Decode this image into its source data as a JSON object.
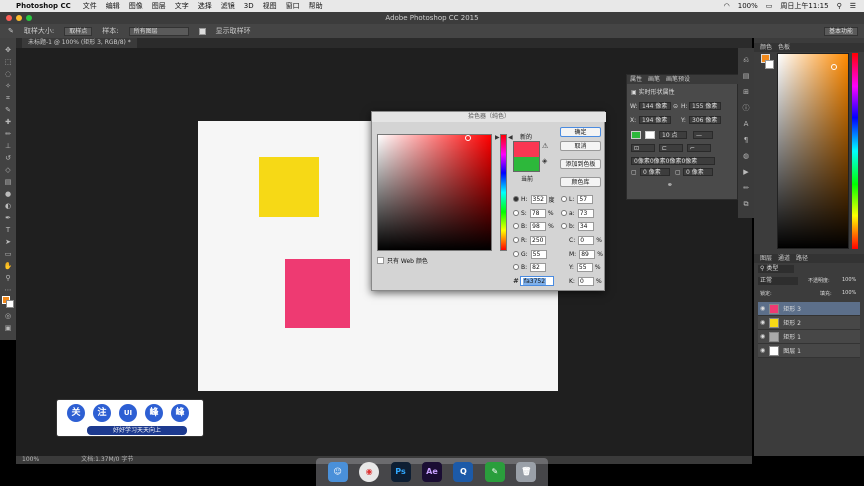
{
  "menubar": {
    "app_name": "Photoshop CC",
    "items": [
      "文件",
      "编辑",
      "图像",
      "图层",
      "文字",
      "选择",
      "滤镜",
      "3D",
      "视图",
      "窗口",
      "帮助"
    ],
    "battery": "100%",
    "clock": "周日上午11:15"
  },
  "window": {
    "title": "Adobe Photoshop CC 2015"
  },
  "options_bar": {
    "sample_size_label": "取样大小:",
    "sample_size_value": "取样点",
    "sample_label": "样本:",
    "sample_value": "所有图层",
    "show_ring_label": "显示取样环",
    "workspace": "基本功能"
  },
  "document": {
    "tab_label": "未标题-1 @ 100% (矩形 3, RGB/8) *",
    "zoom": "100%",
    "doc_info": "文档:1.37M/0 字节"
  },
  "color_picker": {
    "title": "拾色器（纯色）",
    "new_label": "新的",
    "current_label": "当前",
    "new_color": "#fa3752",
    "current_color": "#2db83b",
    "ok": "确定",
    "cancel": "取消",
    "add_swatch": "添加到色板",
    "color_library": "颜色库",
    "web_only": "只有 Web 颜色",
    "hex_label": "#",
    "hex": "fa3752",
    "fields": {
      "H": "352",
      "H_unit": "度",
      "S": "78",
      "S_unit": "%",
      "B": "98",
      "B_unit": "%",
      "R": "250",
      "G": "55",
      "Bl": "82",
      "L": "57",
      "a": "73",
      "b": "34",
      "C": "0",
      "M": "89",
      "Y": "55",
      "K": "0",
      "pct": "%"
    }
  },
  "properties_panel": {
    "tabs": [
      "属性",
      "画笔",
      "画笔预设"
    ],
    "heading": "实时形状属性",
    "W_label": "W:",
    "W": "144 像素",
    "H_label": "H:",
    "H": "155 像素",
    "X_label": "X:",
    "X": "194 像素",
    "Y_label": "Y:",
    "Y": "306 像素",
    "stroke_size": "10 点",
    "radius_summary": "0像素0像素0像素0像素",
    "r1": "0 像素",
    "r2": "0 像素",
    "r3": "0 像素",
    "r4": "0 像素"
  },
  "color_panel": {
    "tabs": [
      "颜色",
      "色板"
    ]
  },
  "layers_panel": {
    "tabs": [
      "图层",
      "通道",
      "路径"
    ],
    "kind": "类型",
    "blend": "正常",
    "opacity_label": "不透明度:",
    "opacity": "100%",
    "lock_label": "锁定:",
    "fill_label": "填充:",
    "fill": "100%",
    "layers": [
      "矩形 3",
      "矩形 2",
      "矩形 1",
      "图层 1"
    ]
  },
  "watermark": {
    "chars": [
      "关",
      "注",
      "UI",
      "峰",
      "峰"
    ],
    "subtitle": "好好学习天天向上"
  },
  "dock": [
    "Finder",
    "Chrome",
    "Ps",
    "Ae",
    "QuickTime",
    "Evernote",
    "Trash"
  ]
}
